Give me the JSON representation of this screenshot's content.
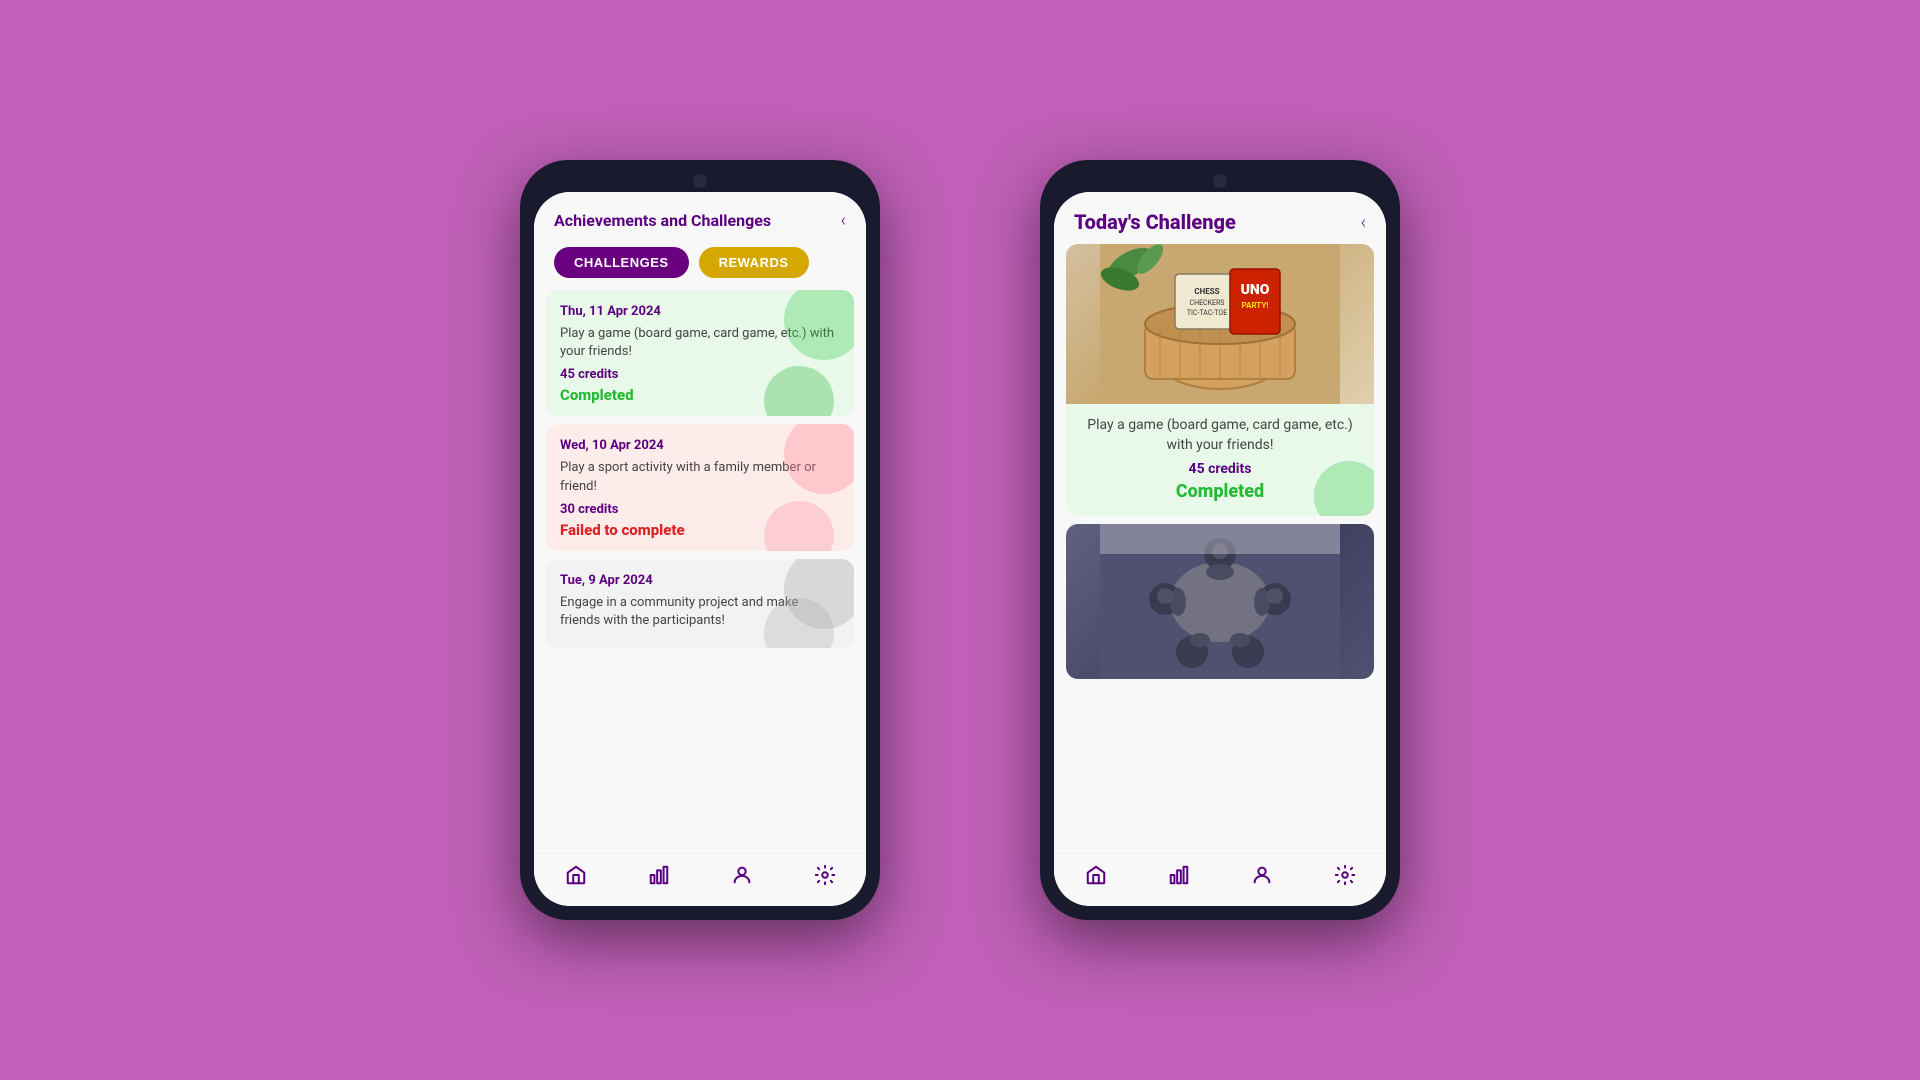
{
  "background_color": "#c060b8",
  "phone_left": {
    "header": {
      "title": "Achievements and Challenges",
      "back_icon": "‹"
    },
    "tabs": [
      {
        "label": "CHALLENGES",
        "state": "active"
      },
      {
        "label": "REWARDS",
        "state": "inactive"
      }
    ],
    "challenges": [
      {
        "date": "Thu, 11 Apr 2024",
        "description": "Play a game (board game, card game, etc.) with your friends!",
        "credits": "45 credits",
        "status": "Completed",
        "status_type": "completed",
        "deco_color1": "green",
        "deco_color2": "green-dark"
      },
      {
        "date": "Wed, 10 Apr 2024",
        "description": "Play a sport activity with a family member or friend!",
        "credits": "30 credits",
        "status": "Failed to complete",
        "status_type": "failed",
        "deco_color1": "pink",
        "deco_color2": "pink"
      },
      {
        "date": "Tue, 9 Apr 2024",
        "description": "Engage in a community project and make friends with the participants!",
        "credits": "",
        "status": "",
        "status_type": "none",
        "deco_color1": "gray",
        "deco_color2": "gray"
      }
    ],
    "nav_icons": [
      "⌂",
      "▦",
      "👤",
      "✿"
    ]
  },
  "phone_right": {
    "header": {
      "title": "Today's Challenge",
      "back_icon": "‹"
    },
    "challenge_cards": [
      {
        "image_type": "boardgame",
        "description": "Play a game (board game, card game, etc.) with your friends!",
        "credits": "45 credits",
        "status": "Completed",
        "status_type": "completed"
      },
      {
        "image_type": "group",
        "description": "",
        "credits": "",
        "status": "",
        "status_type": "none"
      }
    ],
    "nav_icons": [
      "⌂",
      "▦",
      "👤",
      "✿"
    ]
  }
}
